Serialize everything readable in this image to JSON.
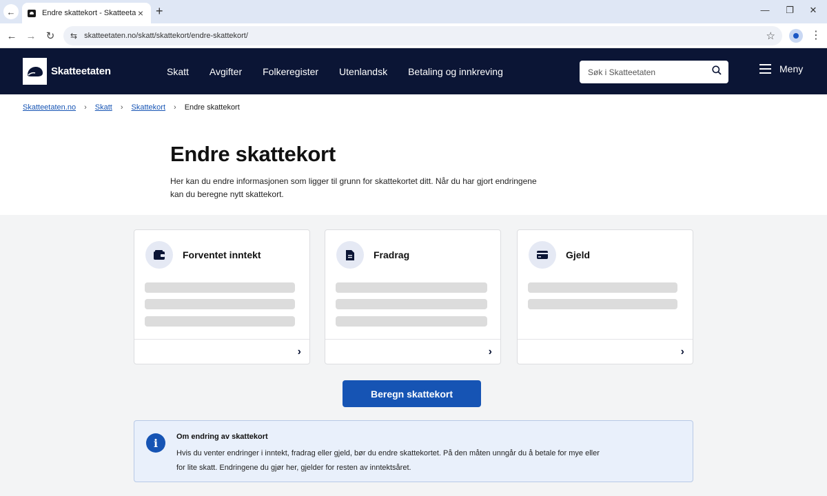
{
  "browser": {
    "tab_title": "Endre skattekort - Skatteetaten",
    "url": "skatteetaten.no/skatt/skattekort/endre-skattekort/"
  },
  "header": {
    "logo_text": "Skatteetaten",
    "nav": [
      "Skatt",
      "Avgifter",
      "Folkeregister",
      "Utenlandsk",
      "Betaling og innkreving"
    ],
    "search_placeholder": "Søk i Skatteetaten",
    "menu_label": "Meny"
  },
  "breadcrumb": {
    "items": [
      "Skatteetaten.no",
      "Skatt",
      "Skattekort"
    ],
    "current": "Endre skattekort"
  },
  "page": {
    "title": "Endre skattekort",
    "intro": "Her kan du endre informasjonen som ligger til grunn for skattekortet ditt. Når du har gjort endringene kan du beregne nytt skattekort."
  },
  "cards": [
    {
      "title": "Forventet inntekt",
      "icon": "wallet-icon"
    },
    {
      "title": "Fradrag",
      "icon": "document-icon"
    },
    {
      "title": "Gjeld",
      "icon": "credit-card-icon"
    }
  ],
  "primary_button": "Beregn skattekort",
  "info": {
    "title": "Om endring av skattekort",
    "text": "Hvis du venter endringer i inntekt, fradrag eller gjeld, bør du endre skattekortet. På den måten unngår du å betale for mye eller for lite skatt. Endringene du gjør her, gjelder for resten av inntektsåret."
  },
  "colors": {
    "header_bg": "#0b1535",
    "accent": "#1654b4",
    "info_bg": "#e9f0fb"
  }
}
